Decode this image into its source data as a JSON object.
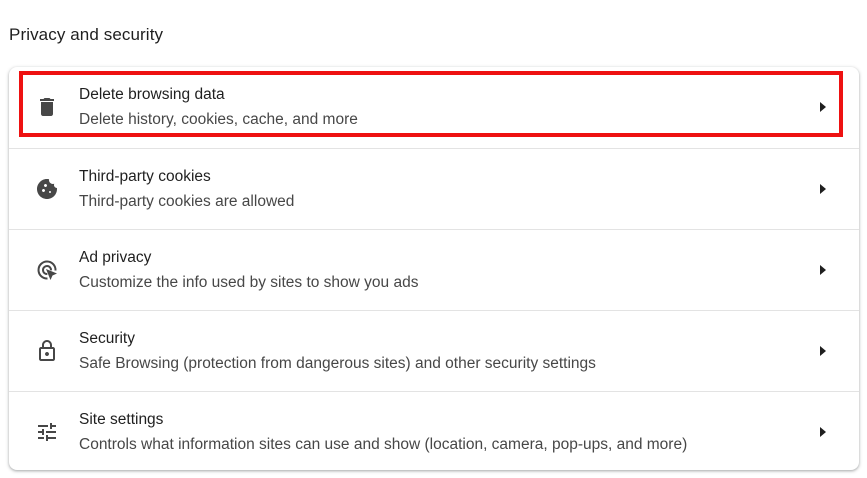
{
  "section": {
    "title": "Privacy and security"
  },
  "items": [
    {
      "label": "Delete browsing data",
      "sublabel": "Delete history, cookies, cache, and more",
      "icon": "trash-icon",
      "highlighted": true
    },
    {
      "label": "Third-party cookies",
      "sublabel": "Third-party cookies are allowed",
      "icon": "cookie-icon",
      "highlighted": false
    },
    {
      "label": "Ad privacy",
      "sublabel": "Customize the info used by sites to show you ads",
      "icon": "ad-privacy-icon",
      "highlighted": false
    },
    {
      "label": "Security",
      "sublabel": "Safe Browsing (protection from dangerous sites) and other security settings",
      "icon": "lock-icon",
      "highlighted": false
    },
    {
      "label": "Site settings",
      "sublabel": "Controls what information sites can use and show (location, camera, pop-ups, and more)",
      "icon": "tune-icon",
      "highlighted": false
    }
  ],
  "colors": {
    "highlight_border": "#ee1111",
    "icon": "#474747",
    "text_primary": "#1f1f1f",
    "text_secondary": "#474747"
  }
}
